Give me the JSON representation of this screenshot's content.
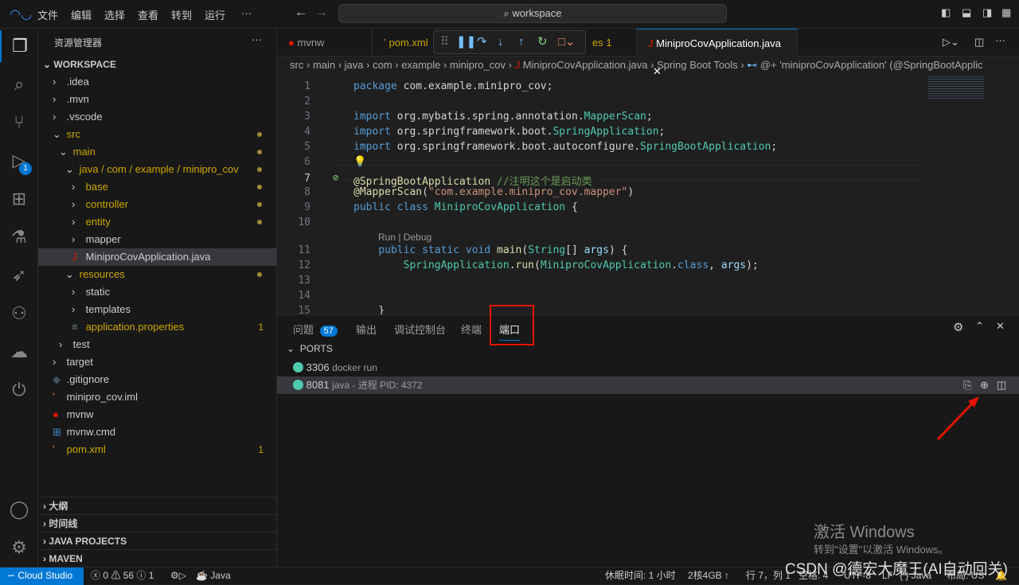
{
  "titlebar": {
    "menus": [
      "文件",
      "编辑",
      "选择",
      "查看",
      "转到",
      "运行",
      "···"
    ],
    "search": "workspace"
  },
  "activity": {
    "debug_badge": "1"
  },
  "sidebar": {
    "title": "资源管理器",
    "more": "···",
    "root": "WORKSPACE",
    "items": [
      {
        "label": ".idea",
        "depth": 1,
        "kind": "folder",
        "color": "#cccccc"
      },
      {
        "label": ".mvn",
        "depth": 1,
        "kind": "folder",
        "color": "#cccccc"
      },
      {
        "label": ".vscode",
        "depth": 1,
        "kind": "folder",
        "color": "#cccccc"
      },
      {
        "label": "src",
        "depth": 1,
        "kind": "open",
        "color": "#cca700",
        "dot": true
      },
      {
        "label": "main",
        "depth": 2,
        "kind": "open",
        "color": "#cca700",
        "dot": true
      },
      {
        "label": "java / com / example / minipro_cov",
        "depth": 3,
        "kind": "open",
        "color": "#cca700",
        "dot": true
      },
      {
        "label": "base",
        "depth": 4,
        "kind": "folder",
        "color": "#cca700",
        "dot": true
      },
      {
        "label": "controller",
        "depth": 4,
        "kind": "folder",
        "color": "#cca700",
        "dot": true
      },
      {
        "label": "entity",
        "depth": 4,
        "kind": "folder",
        "color": "#cca700",
        "dot": true
      },
      {
        "label": "mapper",
        "depth": 4,
        "kind": "folder",
        "color": "#cccccc"
      },
      {
        "label": "MiniproCovApplication.java",
        "depth": 4,
        "kind": "java",
        "color": "#cccccc",
        "selected": true
      },
      {
        "label": "resources",
        "depth": 3,
        "kind": "open",
        "color": "#cca700",
        "dot": true
      },
      {
        "label": "static",
        "depth": 4,
        "kind": "folder",
        "color": "#cccccc"
      },
      {
        "label": "templates",
        "depth": 4,
        "kind": "folder",
        "color": "#cccccc"
      },
      {
        "label": "application.properties",
        "depth": 4,
        "kind": "props",
        "color": "#cca700",
        "badge": "1"
      },
      {
        "label": "test",
        "depth": 2,
        "kind": "folder",
        "color": "#cccccc"
      },
      {
        "label": "target",
        "depth": 1,
        "kind": "folder",
        "color": "#cccccc"
      },
      {
        "label": ".gitignore",
        "depth": 1,
        "kind": "git",
        "color": "#cccccc"
      },
      {
        "label": "minipro_cov.iml",
        "depth": 1,
        "kind": "rss",
        "color": "#cccccc"
      },
      {
        "label": "mvnw",
        "depth": 1,
        "kind": "mvnw",
        "color": "#cccccc"
      },
      {
        "label": "mvnw.cmd",
        "depth": 1,
        "kind": "win",
        "color": "#cccccc"
      },
      {
        "label": "pom.xml",
        "depth": 1,
        "kind": "rss",
        "color": "#cca700",
        "badge": "1"
      }
    ],
    "sections": [
      "大纲",
      "时间线",
      "JAVA PROJECTS",
      "MAVEN"
    ]
  },
  "tabs": [
    {
      "label": "mvnw"
    },
    {
      "label": "pom.xml"
    },
    {
      "label": "es 1"
    },
    {
      "label": "MiniproCovApplication.java",
      "active": true
    }
  ],
  "breadcrumbs": [
    "src",
    "main",
    "java",
    "com",
    "example",
    "minipro_cov",
    "MiniproCovApplication.java",
    "Spring Boot Tools",
    "@+ 'miniproCovApplication' (@SpringBootApplic"
  ],
  "code": {
    "codelens": "Run | Debug"
  },
  "panel": {
    "tabs": [
      {
        "label": "问题",
        "badge": "57"
      },
      {
        "label": "输出"
      },
      {
        "label": "调试控制台"
      },
      {
        "label": "终端"
      },
      {
        "label": "端口",
        "active": true
      }
    ],
    "section": "PORTS",
    "ports": [
      {
        "port": "3306",
        "desc": "docker run"
      },
      {
        "port": "8081",
        "desc": "java - 进程 PID: 4372",
        "selected": true
      }
    ]
  },
  "statusbar": {
    "remote": "Cloud Studio",
    "errors": "0",
    "warnings": "56",
    "infos": "1",
    "java": "Java",
    "sleep": "休眠时间: 1 小时",
    "machine": "2核4GB ↑",
    "position": "行 7，列 1",
    "spaces": "空格: 4",
    "encoding": "UTF-8",
    "eol": "LF",
    "lang": "{ } Java",
    "layout": "布局: US"
  },
  "watermark": {
    "activate": "激活 Windows",
    "activate_sub": "转到\"设置\"以激活 Windows。",
    "csdn": "CSDN @德宏大魔王(AI自动回关)"
  },
  "colors": {
    "accent": "#0078d4",
    "port_dot": "#4ec9b0",
    "highlight": "#e51400"
  }
}
